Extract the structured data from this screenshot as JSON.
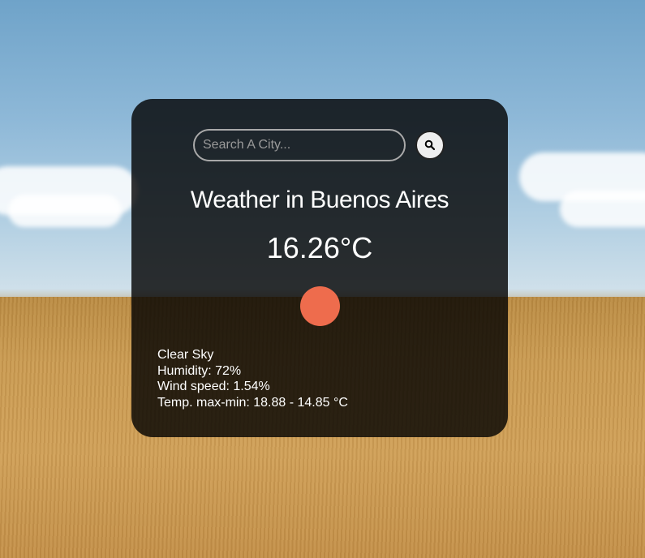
{
  "search": {
    "placeholder": "Search A City..."
  },
  "weather": {
    "title": "Weather in Buenos Aires",
    "temperature": "16.26°C",
    "icon": "sun-icon",
    "description": "Clear Sky",
    "humidity": "Humidity: 72%",
    "wind": "Wind speed: 1.54%",
    "temp_range": "Temp. max-min: 18.88 - 14.85 °C"
  },
  "colors": {
    "card_bg": "#000000cc",
    "icon_color": "#ee6c4d",
    "search_button_bg": "#eeeeee"
  }
}
